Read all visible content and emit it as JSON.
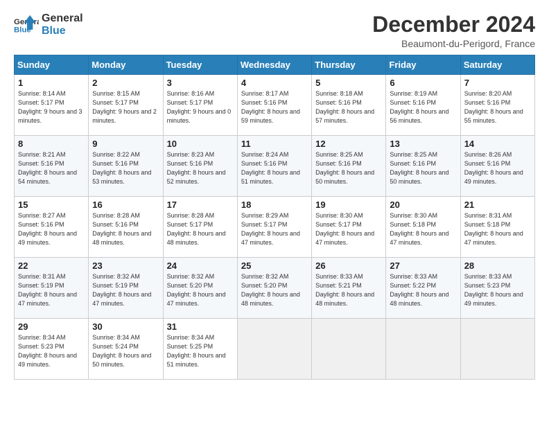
{
  "header": {
    "logo_line1": "General",
    "logo_line2": "Blue",
    "month": "December 2024",
    "location": "Beaumont-du-Perigord, France"
  },
  "weekdays": [
    "Sunday",
    "Monday",
    "Tuesday",
    "Wednesday",
    "Thursday",
    "Friday",
    "Saturday"
  ],
  "weeks": [
    [
      {
        "day": "1",
        "sunrise": "Sunrise: 8:14 AM",
        "sunset": "Sunset: 5:17 PM",
        "daylight": "Daylight: 9 hours and 3 minutes."
      },
      {
        "day": "2",
        "sunrise": "Sunrise: 8:15 AM",
        "sunset": "Sunset: 5:17 PM",
        "daylight": "Daylight: 9 hours and 2 minutes."
      },
      {
        "day": "3",
        "sunrise": "Sunrise: 8:16 AM",
        "sunset": "Sunset: 5:17 PM",
        "daylight": "Daylight: 9 hours and 0 minutes."
      },
      {
        "day": "4",
        "sunrise": "Sunrise: 8:17 AM",
        "sunset": "Sunset: 5:16 PM",
        "daylight": "Daylight: 8 hours and 59 minutes."
      },
      {
        "day": "5",
        "sunrise": "Sunrise: 8:18 AM",
        "sunset": "Sunset: 5:16 PM",
        "daylight": "Daylight: 8 hours and 57 minutes."
      },
      {
        "day": "6",
        "sunrise": "Sunrise: 8:19 AM",
        "sunset": "Sunset: 5:16 PM",
        "daylight": "Daylight: 8 hours and 56 minutes."
      },
      {
        "day": "7",
        "sunrise": "Sunrise: 8:20 AM",
        "sunset": "Sunset: 5:16 PM",
        "daylight": "Daylight: 8 hours and 55 minutes."
      }
    ],
    [
      {
        "day": "8",
        "sunrise": "Sunrise: 8:21 AM",
        "sunset": "Sunset: 5:16 PM",
        "daylight": "Daylight: 8 hours and 54 minutes."
      },
      {
        "day": "9",
        "sunrise": "Sunrise: 8:22 AM",
        "sunset": "Sunset: 5:16 PM",
        "daylight": "Daylight: 8 hours and 53 minutes."
      },
      {
        "day": "10",
        "sunrise": "Sunrise: 8:23 AM",
        "sunset": "Sunset: 5:16 PM",
        "daylight": "Daylight: 8 hours and 52 minutes."
      },
      {
        "day": "11",
        "sunrise": "Sunrise: 8:24 AM",
        "sunset": "Sunset: 5:16 PM",
        "daylight": "Daylight: 8 hours and 51 minutes."
      },
      {
        "day": "12",
        "sunrise": "Sunrise: 8:25 AM",
        "sunset": "Sunset: 5:16 PM",
        "daylight": "Daylight: 8 hours and 50 minutes."
      },
      {
        "day": "13",
        "sunrise": "Sunrise: 8:25 AM",
        "sunset": "Sunset: 5:16 PM",
        "daylight": "Daylight: 8 hours and 50 minutes."
      },
      {
        "day": "14",
        "sunrise": "Sunrise: 8:26 AM",
        "sunset": "Sunset: 5:16 PM",
        "daylight": "Daylight: 8 hours and 49 minutes."
      }
    ],
    [
      {
        "day": "15",
        "sunrise": "Sunrise: 8:27 AM",
        "sunset": "Sunset: 5:16 PM",
        "daylight": "Daylight: 8 hours and 49 minutes."
      },
      {
        "day": "16",
        "sunrise": "Sunrise: 8:28 AM",
        "sunset": "Sunset: 5:16 PM",
        "daylight": "Daylight: 8 hours and 48 minutes."
      },
      {
        "day": "17",
        "sunrise": "Sunrise: 8:28 AM",
        "sunset": "Sunset: 5:17 PM",
        "daylight": "Daylight: 8 hours and 48 minutes."
      },
      {
        "day": "18",
        "sunrise": "Sunrise: 8:29 AM",
        "sunset": "Sunset: 5:17 PM",
        "daylight": "Daylight: 8 hours and 47 minutes."
      },
      {
        "day": "19",
        "sunrise": "Sunrise: 8:30 AM",
        "sunset": "Sunset: 5:17 PM",
        "daylight": "Daylight: 8 hours and 47 minutes."
      },
      {
        "day": "20",
        "sunrise": "Sunrise: 8:30 AM",
        "sunset": "Sunset: 5:18 PM",
        "daylight": "Daylight: 8 hours and 47 minutes."
      },
      {
        "day": "21",
        "sunrise": "Sunrise: 8:31 AM",
        "sunset": "Sunset: 5:18 PM",
        "daylight": "Daylight: 8 hours and 47 minutes."
      }
    ],
    [
      {
        "day": "22",
        "sunrise": "Sunrise: 8:31 AM",
        "sunset": "Sunset: 5:19 PM",
        "daylight": "Daylight: 8 hours and 47 minutes."
      },
      {
        "day": "23",
        "sunrise": "Sunrise: 8:32 AM",
        "sunset": "Sunset: 5:19 PM",
        "daylight": "Daylight: 8 hours and 47 minutes."
      },
      {
        "day": "24",
        "sunrise": "Sunrise: 8:32 AM",
        "sunset": "Sunset: 5:20 PM",
        "daylight": "Daylight: 8 hours and 47 minutes."
      },
      {
        "day": "25",
        "sunrise": "Sunrise: 8:32 AM",
        "sunset": "Sunset: 5:20 PM",
        "daylight": "Daylight: 8 hours and 48 minutes."
      },
      {
        "day": "26",
        "sunrise": "Sunrise: 8:33 AM",
        "sunset": "Sunset: 5:21 PM",
        "daylight": "Daylight: 8 hours and 48 minutes."
      },
      {
        "day": "27",
        "sunrise": "Sunrise: 8:33 AM",
        "sunset": "Sunset: 5:22 PM",
        "daylight": "Daylight: 8 hours and 48 minutes."
      },
      {
        "day": "28",
        "sunrise": "Sunrise: 8:33 AM",
        "sunset": "Sunset: 5:23 PM",
        "daylight": "Daylight: 8 hours and 49 minutes."
      }
    ],
    [
      {
        "day": "29",
        "sunrise": "Sunrise: 8:34 AM",
        "sunset": "Sunset: 5:23 PM",
        "daylight": "Daylight: 8 hours and 49 minutes."
      },
      {
        "day": "30",
        "sunrise": "Sunrise: 8:34 AM",
        "sunset": "Sunset: 5:24 PM",
        "daylight": "Daylight: 8 hours and 50 minutes."
      },
      {
        "day": "31",
        "sunrise": "Sunrise: 8:34 AM",
        "sunset": "Sunset: 5:25 PM",
        "daylight": "Daylight: 8 hours and 51 minutes."
      },
      null,
      null,
      null,
      null
    ]
  ]
}
